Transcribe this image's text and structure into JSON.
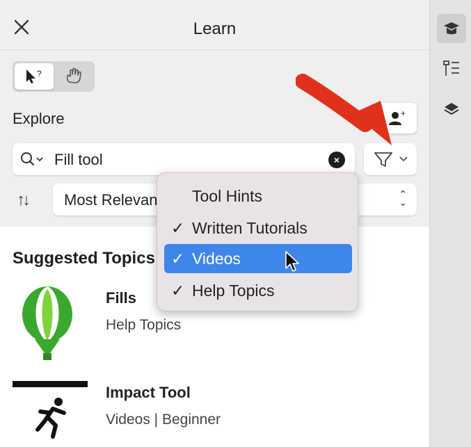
{
  "header": {
    "title": "Learn"
  },
  "explore": {
    "label": "Explore"
  },
  "search": {
    "value": "Fill tool"
  },
  "sort": {
    "value": "Most Relevant"
  },
  "suggested": {
    "title": "Suggested Topics"
  },
  "items": [
    {
      "title": "Fills",
      "subtitle": "Help Topics",
      "thumb": "coreldraw-balloon-logo"
    },
    {
      "title": "Impact Tool",
      "subtitle": "Videos | Beginner",
      "thumb": "running-figure-video"
    }
  ],
  "filter_menu": {
    "items": [
      {
        "label": "Tool Hints",
        "checked": false,
        "selected": false
      },
      {
        "label": "Written Tutorials",
        "checked": true,
        "selected": false
      },
      {
        "label": "Videos",
        "checked": true,
        "selected": true
      },
      {
        "label": "Help Topics",
        "checked": true,
        "selected": false
      }
    ],
    "check_glyph": "✓"
  },
  "icons": {
    "close": "close-icon",
    "hint_mode": "pointer-question-icon",
    "hand_mode": "hand-icon",
    "community": "person-add-icon",
    "search": "magnifier-dropdown-icon",
    "filter": "funnel-icon",
    "sort": "sort-arrows-icon",
    "side_learn": "graduation-cap-icon",
    "side_properties": "properties-icon",
    "side_layers": "layers-icon"
  },
  "colors": {
    "selection": "#3f86e9",
    "annotation_arrow": "#e0321b"
  }
}
